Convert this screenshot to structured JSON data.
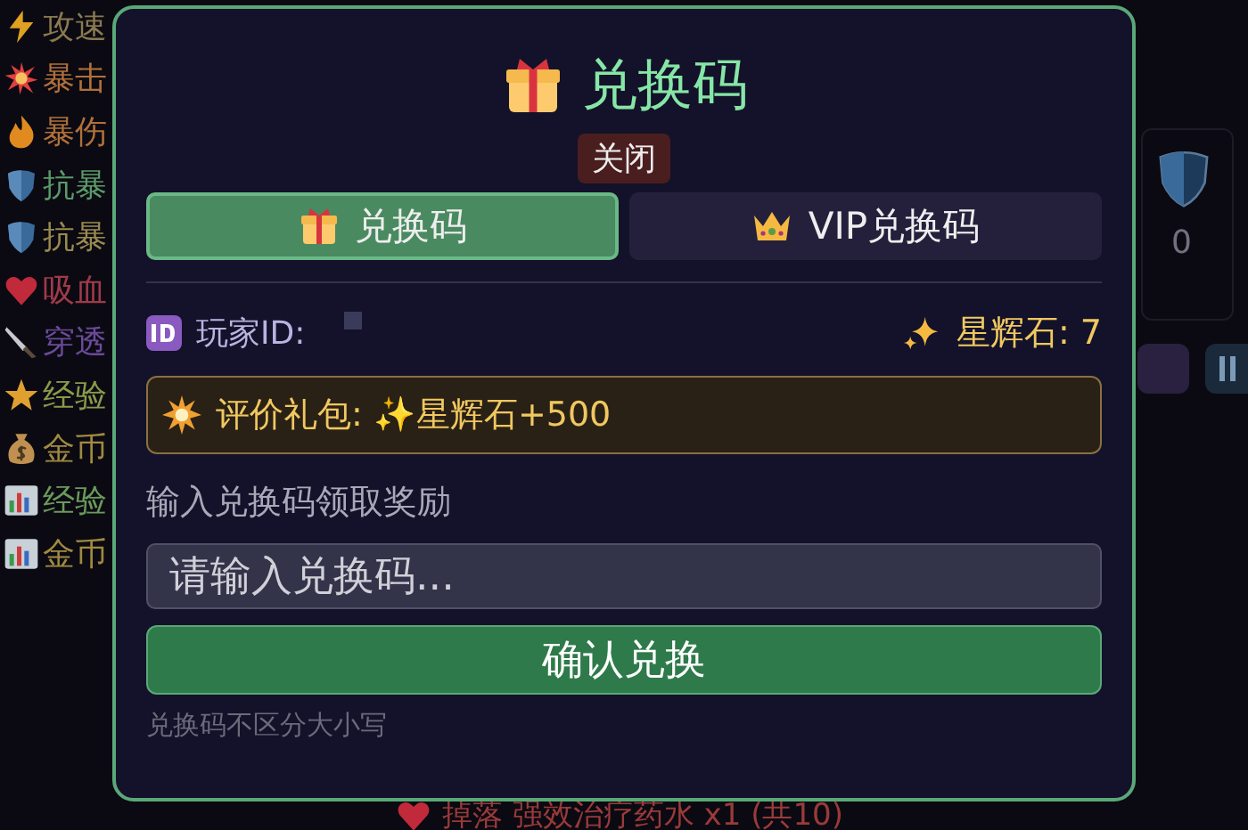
{
  "background": {
    "stats": [
      {
        "label": "攻速",
        "kind": "bolt",
        "color": "#8a7a50"
      },
      {
        "label": "暴击",
        "kind": "burst",
        "color": "#b0703a"
      },
      {
        "label": "暴伤",
        "kind": "flame",
        "color": "#b0703a"
      },
      {
        "label": "抗暴",
        "kind": "shield",
        "color": "#5a9a6a"
      },
      {
        "label": "抗暴",
        "kind": "shield",
        "color": "#9a8a50"
      },
      {
        "label": "吸血",
        "kind": "heart",
        "color": "#a03a4a"
      },
      {
        "label": "穿透",
        "kind": "knife",
        "color": "#6a4a9a"
      },
      {
        "label": "经验",
        "kind": "star",
        "color": "#8a9a4a"
      },
      {
        "label": "金币",
        "kind": "moneybag",
        "color": "#a08a40"
      },
      {
        "label": "经验",
        "kind": "chart",
        "color": "#6a9a5a"
      },
      {
        "label": "金币",
        "kind": "chart",
        "color": "#a08a40"
      }
    ],
    "shield_value": "0",
    "drop_message": "掉落 强效治疗药水 x1 (共10)"
  },
  "dialog": {
    "title": "兑换码",
    "close_label": "关闭",
    "tabs": [
      {
        "label": "兑换码",
        "kind": "gift",
        "selected": true
      },
      {
        "label": "VIP兑换码",
        "kind": "crown",
        "selected": false
      }
    ],
    "player_id_label": "玩家ID:",
    "star_stone": "星辉石: 7",
    "promo": "评价礼包: ✨星辉石+500",
    "prompt": "输入兑换码领取奖励",
    "input": {
      "placeholder": "请输入兑换码..."
    },
    "confirm_label": "确认兑换",
    "hint": "兑换码不区分大小写"
  }
}
